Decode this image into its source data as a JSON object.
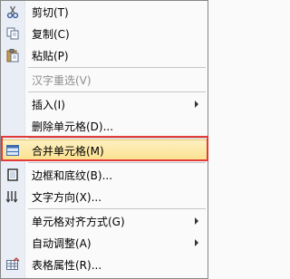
{
  "menu": {
    "items": [
      {
        "label": "剪切(T)",
        "icon": "scissors-icon",
        "disabled": false,
        "submenu": false
      },
      {
        "label": "复制(C)",
        "icon": "copy-icon",
        "disabled": false,
        "submenu": false
      },
      {
        "label": "粘贴(P)",
        "icon": "paste-icon",
        "disabled": false,
        "submenu": false
      },
      {
        "label": "汉字重选(V)",
        "icon": "",
        "disabled": true,
        "submenu": false
      },
      {
        "label": "插入(I)",
        "icon": "",
        "disabled": false,
        "submenu": true
      },
      {
        "label": "删除单元格(D)...",
        "icon": "",
        "disabled": false,
        "submenu": false
      },
      {
        "label": "合并单元格(M)",
        "icon": "merge-cells-icon",
        "disabled": false,
        "submenu": false,
        "highlighted": true
      },
      {
        "label": "边框和底纹(B)...",
        "icon": "borders-shading-icon",
        "disabled": false,
        "submenu": false
      },
      {
        "label": "文字方向(X)...",
        "icon": "text-direction-icon",
        "disabled": false,
        "submenu": false
      },
      {
        "label": "单元格对齐方式(G)",
        "icon": "",
        "disabled": false,
        "submenu": true
      },
      {
        "label": "自动调整(A)",
        "icon": "",
        "disabled": false,
        "submenu": true
      },
      {
        "label": "表格属性(R)...",
        "icon": "table-properties-icon",
        "disabled": false,
        "submenu": false
      }
    ]
  },
  "colors": {
    "highlight_box": "#e33a3a",
    "gutter": "#e9eef6"
  }
}
